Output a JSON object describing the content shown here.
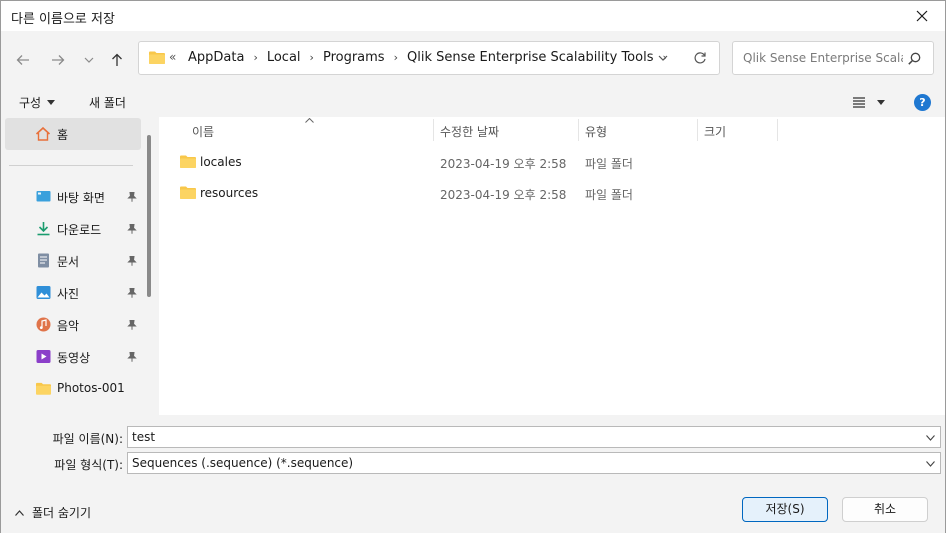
{
  "window": {
    "title": "다른 이름으로 저장"
  },
  "address": {
    "overflow": "«",
    "crumbs": [
      "AppData",
      "Local",
      "Programs",
      "Qlik Sense Enterprise Scalability Tools"
    ],
    "separator": "›"
  },
  "search": {
    "placeholder": "Qlik Sense Enterprise Scala..."
  },
  "toolbar": {
    "organize_label": "구성",
    "new_folder_label": "새 폴더",
    "help_label": "?"
  },
  "sidebar": {
    "home_label": "홈",
    "items": [
      {
        "label": "바탕 화면",
        "icon": "desktop-icon",
        "pinned": true
      },
      {
        "label": "다운로드",
        "icon": "download-icon",
        "pinned": true
      },
      {
        "label": "문서",
        "icon": "document-icon",
        "pinned": true
      },
      {
        "label": "사진",
        "icon": "pictures-icon",
        "pinned": true
      },
      {
        "label": "음악",
        "icon": "music-icon",
        "pinned": true
      },
      {
        "label": "동영상",
        "icon": "video-icon",
        "pinned": true
      },
      {
        "label": "Photos-001",
        "icon": "folder-icon",
        "pinned": false
      }
    ]
  },
  "filelist": {
    "columns": {
      "name": "이름",
      "modified": "수정한 날짜",
      "type": "유형",
      "size": "크기"
    },
    "rows": [
      {
        "name": "locales",
        "modified": "2023-04-19 오후 2:58",
        "type": "파일 폴더"
      },
      {
        "name": "resources",
        "modified": "2023-04-19 오후 2:58",
        "type": "파일 폴더"
      }
    ]
  },
  "form": {
    "filename_label": "파일 이름(N):",
    "filename_value": "test",
    "filetype_label": "파일 형식(T):",
    "filetype_value": "Sequences (.sequence) (*.sequence)"
  },
  "footer": {
    "hide_folders_label": "폴더 숨기기",
    "save_label": "저장(S)",
    "cancel_label": "취소"
  },
  "colors": {
    "accent": "#0067c0",
    "folder": "#f8c74a",
    "help": "#1f78d1",
    "selected_nav": "#e1e1e1"
  }
}
